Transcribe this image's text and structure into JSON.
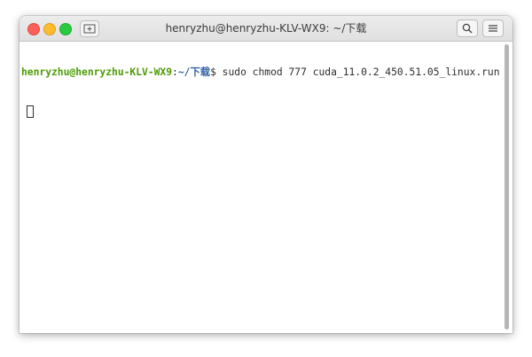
{
  "window": {
    "title": "henryzhu@henryzhu-KLV-WX9: ~/下载"
  },
  "titlebar": {
    "new_tab_icon": "new-tab-icon",
    "search_icon": "search-icon",
    "menu_icon": "hamburger-menu-icon"
  },
  "terminal": {
    "prompt_user": "henryzhu@henryzhu-KLV-WX9",
    "prompt_sep": ":",
    "prompt_path": "~/下载",
    "prompt_symbol": "$ ",
    "command": "sudo chmod 777 cuda_11.0.2_450.51.05_linux.run"
  },
  "colors": {
    "user": "#4e9a06",
    "path": "#3465a4",
    "close": "#fc5f57",
    "minimize": "#fdbc2e",
    "maximize": "#29c940"
  }
}
